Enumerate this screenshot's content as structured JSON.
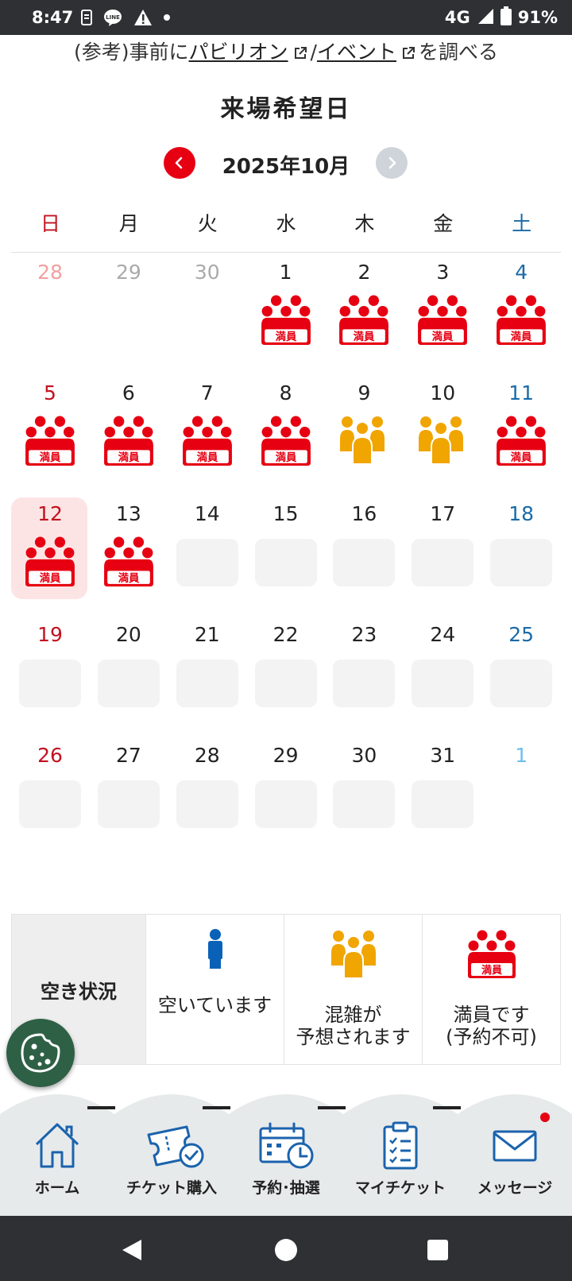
{
  "status_bar": {
    "time": "8:47",
    "network": "4G",
    "battery": "91%"
  },
  "ref_line": {
    "prefix": "(参考)事前に",
    "pavilion_link": "パビリオン",
    "separator": "/",
    "event_link": "イベント",
    "suffix": "を調べる"
  },
  "calendar": {
    "title": "来場希望日",
    "month_label": "2025年10月",
    "weekdays": [
      "日",
      "月",
      "火",
      "水",
      "木",
      "金",
      "土"
    ],
    "weeks": [
      [
        {
          "d": "28",
          "m": "prev",
          "s": "none"
        },
        {
          "d": "29",
          "m": "prev",
          "s": "none"
        },
        {
          "d": "30",
          "m": "prev",
          "s": "none"
        },
        {
          "d": "1",
          "m": "cur",
          "s": "full"
        },
        {
          "d": "2",
          "m": "cur",
          "s": "full"
        },
        {
          "d": "3",
          "m": "cur",
          "s": "full"
        },
        {
          "d": "4",
          "m": "cur",
          "s": "full"
        }
      ],
      [
        {
          "d": "5",
          "m": "cur",
          "s": "full"
        },
        {
          "d": "6",
          "m": "cur",
          "s": "full"
        },
        {
          "d": "7",
          "m": "cur",
          "s": "full"
        },
        {
          "d": "8",
          "m": "cur",
          "s": "full"
        },
        {
          "d": "9",
          "m": "cur",
          "s": "crowded"
        },
        {
          "d": "10",
          "m": "cur",
          "s": "crowded"
        },
        {
          "d": "11",
          "m": "cur",
          "s": "full"
        }
      ],
      [
        {
          "d": "12",
          "m": "cur",
          "s": "full",
          "selected": true
        },
        {
          "d": "13",
          "m": "cur",
          "s": "full"
        },
        {
          "d": "14",
          "m": "cur",
          "s": "empty"
        },
        {
          "d": "15",
          "m": "cur",
          "s": "empty"
        },
        {
          "d": "16",
          "m": "cur",
          "s": "empty"
        },
        {
          "d": "17",
          "m": "cur",
          "s": "empty"
        },
        {
          "d": "18",
          "m": "cur",
          "s": "empty"
        }
      ],
      [
        {
          "d": "19",
          "m": "cur",
          "s": "empty"
        },
        {
          "d": "20",
          "m": "cur",
          "s": "empty"
        },
        {
          "d": "21",
          "m": "cur",
          "s": "empty"
        },
        {
          "d": "22",
          "m": "cur",
          "s": "empty"
        },
        {
          "d": "23",
          "m": "cur",
          "s": "empty"
        },
        {
          "d": "24",
          "m": "cur",
          "s": "empty"
        },
        {
          "d": "25",
          "m": "cur",
          "s": "empty"
        }
      ],
      [
        {
          "d": "26",
          "m": "cur",
          "s": "empty"
        },
        {
          "d": "27",
          "m": "cur",
          "s": "empty"
        },
        {
          "d": "28",
          "m": "cur",
          "s": "empty"
        },
        {
          "d": "29",
          "m": "cur",
          "s": "empty"
        },
        {
          "d": "30",
          "m": "cur",
          "s": "empty"
        },
        {
          "d": "31",
          "m": "cur",
          "s": "empty"
        },
        {
          "d": "1",
          "m": "next",
          "s": "none"
        }
      ]
    ],
    "full_badge_text": "満員"
  },
  "legend": {
    "heading": "空き状況",
    "available": "空いています",
    "crowded_line1": "混雑が",
    "crowded_line2": "予想されます",
    "full_line1": "満員です",
    "full_line2": "(予約不可)"
  },
  "tabs": [
    "ホーム",
    "チケット購入",
    "予約･抽選",
    "マイチケット",
    "メッセージ"
  ],
  "colors": {
    "accent_red": "#e60012",
    "crowded_orange": "#f0a500",
    "available_blue": "#0a62b8",
    "sunday_red": "#c1121f",
    "saturday_blue": "#1a6aa8",
    "tab_blue": "#1b63ad",
    "cookie_green": "#2e6045"
  }
}
